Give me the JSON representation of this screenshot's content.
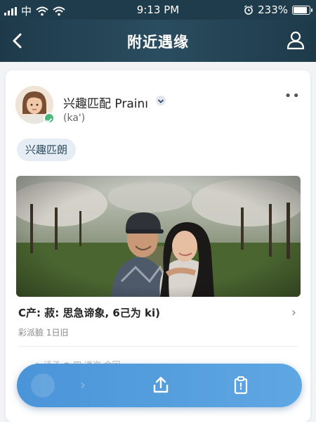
{
  "status_bar": {
    "carrier": "中",
    "time": "9:13 PM",
    "battery": "233%",
    "battery_level": 0.9
  },
  "header": {
    "title": "附近遇缘",
    "back_icon": "back-chevron-icon",
    "profile_icon": "user-icon"
  },
  "post": {
    "author_name": "兴趣匹配 Prainı",
    "author_sub": "(ka')",
    "more": "••",
    "tag": "兴趣匹朗",
    "caption": "C产:  菽:  思急谛象, 6己为 ki)",
    "meta": "彩派臉  1日旧",
    "faded_row": "✦  话子          ●  四 递迩     余回"
  },
  "dock": {
    "share_icon": "share-icon",
    "clipboard_icon": "clipboard-icon"
  },
  "colors": {
    "header_bg": "#1f3c4c",
    "dock_blue": "#4a94d8",
    "badge_green": "#49b87a"
  }
}
